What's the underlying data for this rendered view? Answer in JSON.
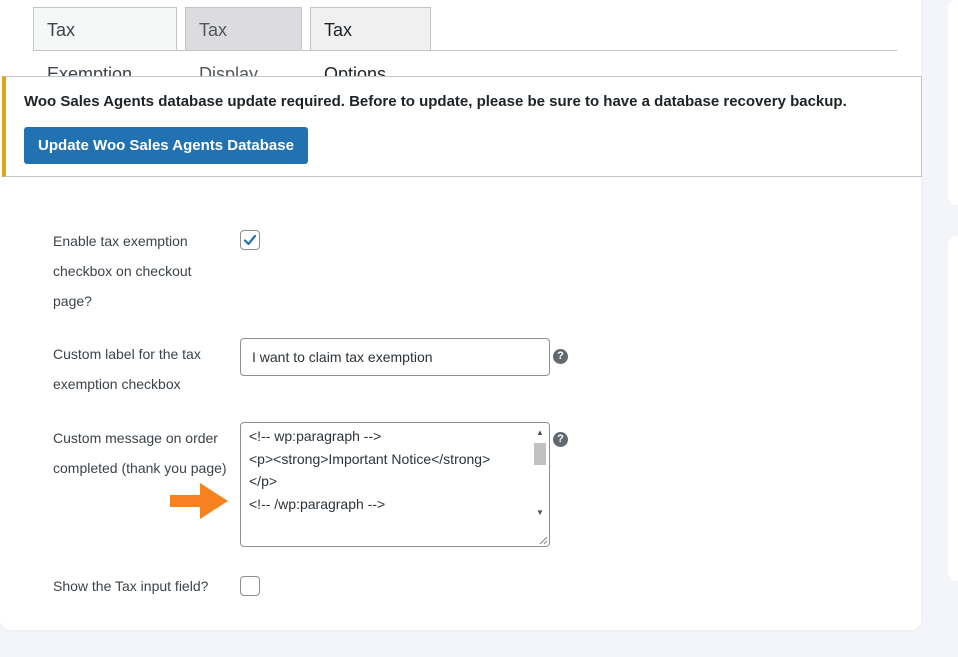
{
  "tabs": [
    {
      "label": "Tax Exemption"
    },
    {
      "label": "Tax Display"
    },
    {
      "label": "Tax Options"
    }
  ],
  "notice": {
    "text": "Woo Sales Agents database update required. Before to update, please be sure to have a database recovery backup.",
    "button_label": "Update Woo Sales Agents Database",
    "accent_color": "#dba617",
    "button_color": "#2271b1"
  },
  "fields": {
    "enable_checkbox": {
      "label": "Enable tax exemption checkbox on checkout page?",
      "checked": true
    },
    "custom_label": {
      "label": "Custom label for the tax exemption checkbox",
      "value": "I want to claim tax exemption",
      "help_icon": "question-icon"
    },
    "custom_message": {
      "label": "Custom message on order completed (thank you page)",
      "lines": [
        "<!-- wp:paragraph -->",
        "<p><strong>Important Notice</strong>",
        "</p>",
        "<!-- /wp:paragraph -->"
      ],
      "help_icon": "question-icon"
    },
    "show_tax_input": {
      "label": "Show the Tax input field?",
      "checked": false
    }
  },
  "arrow_color": "#f5821f"
}
